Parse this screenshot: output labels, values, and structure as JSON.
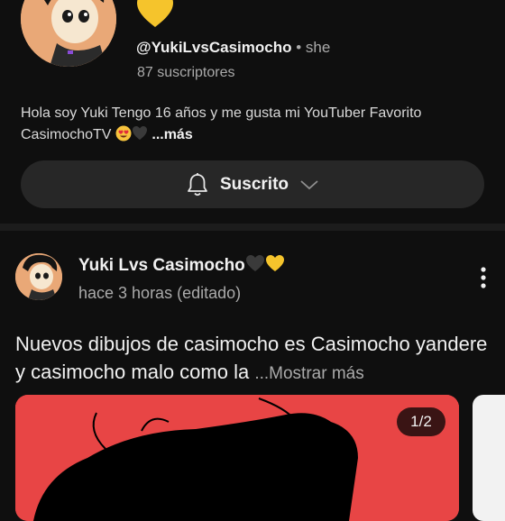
{
  "channel": {
    "handle": "@YukiLvsCasimocho",
    "pronoun": " • she",
    "subscribers": "87 suscriptores",
    "bio_text": "Hola soy Yuki Tengo 16 años y me gusta mi YouTuber Favorito CasimochoTV ",
    "bio_more": " ...más",
    "accent_yellow": "#f5c42c"
  },
  "subscribe_button": {
    "label": "Suscrito",
    "icons": [
      "bell-icon",
      "chevron-down-icon"
    ]
  },
  "post": {
    "author": "Yuki Lvs Casimocho",
    "time": "hace 3 horas (editado)",
    "text": "Nuevos dibujos de casimocho es Casimocho yandere y casimocho malo como la ",
    "more": "...Mostrar más",
    "image_counter": "1/2",
    "image_bg": "#e84545"
  }
}
